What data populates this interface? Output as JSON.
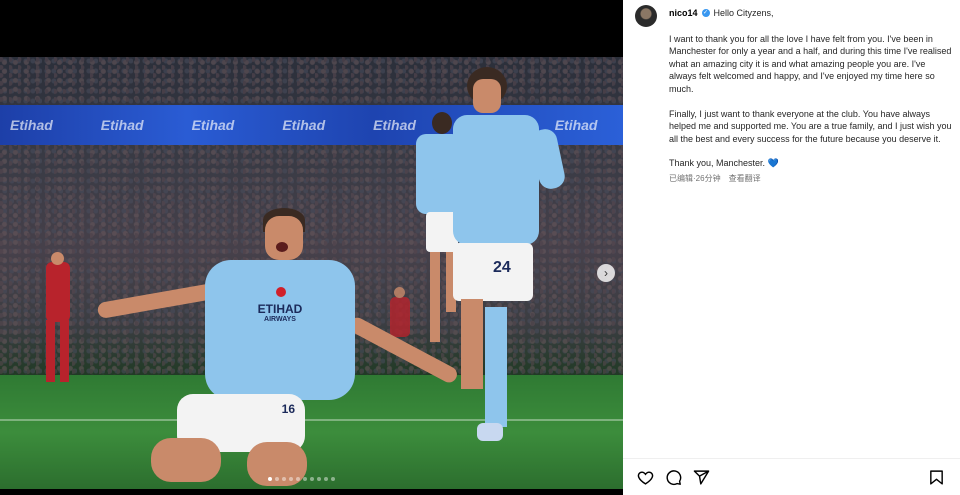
{
  "media": {
    "banner_text": [
      "Etihad",
      "Etihad",
      "Etihad",
      "Etihad",
      "Etihad",
      "Etihad",
      "Etihad"
    ],
    "shirt_number_left": "16",
    "shirt_number_right": "24",
    "sponsor": "ETIHAD",
    "sponsor_sub": "AIRWAYS",
    "carousel": {
      "total": 10,
      "active_index": 0
    },
    "next_icon": "chevron-right-icon"
  },
  "post": {
    "username": "nico14",
    "greeting": "Hello Cityzens,",
    "paragraphs": [
      "I want to thank you for all the love I have felt from you. I've been in Manchester for only a year and a half, and during this time I've realised what an amazing city it is and what amazing people you are. I've always felt welcomed and happy, and I've enjoyed my time here so much.",
      "Finally, I just want to thank everyone at the club. You have always helped me and supported me. You are a true family, and I just wish you all the best and every success for the future because you deserve it."
    ],
    "signoff": "Thank you, Manchester.",
    "signoff_emoji": "💙",
    "edited_label": "已编辑",
    "separator": "·",
    "time_ago": "26分钟",
    "translate_label": "查看翻译"
  },
  "actions": {
    "like_icon": "heart-icon",
    "comment_icon": "comment-icon",
    "share_icon": "share-icon",
    "save_icon": "bookmark-icon"
  },
  "colors": {
    "verified": "#3897f0",
    "city_blue": "#8ec5ec",
    "banner_blue": "#2a5cd4",
    "pitch_green": "#3c8d3c"
  }
}
